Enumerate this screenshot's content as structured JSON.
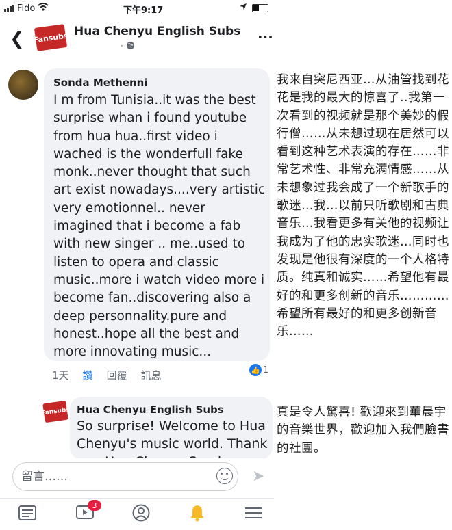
{
  "status_bar": {
    "carrier": "Fido",
    "time": "下午9:17"
  },
  "header": {
    "page_name": "Hua Chenyu English Subs",
    "sub": "·",
    "logo_text": "Fansubs"
  },
  "comment": {
    "author": "Sonda Methenni",
    "text": "I m from Tunisia..it was the best surprise whan i found youtube from hua hua..first video i wached is the wonderfull fake monk..never thought that such art exist nowadays....very artistic very emotionnel.. never imagined that i become a fab with new singer .. me..used to listen to opera and classic music..more i watch video more i become fan..discovering also a deep personnality.pure and honest..hope all the best and more innovating music...",
    "time": "1天",
    "like": "讚",
    "reply": "回覆",
    "message": "訊息",
    "reaction_count": "1"
  },
  "reply": {
    "author": "Hua Chenyu English Subs",
    "text": "So surprise!  Welcome to Hua Chenyu's music world. Thank you Hua Chenyu Sonda Methenni",
    "logo_text": "Fansubs"
  },
  "input": {
    "placeholder": "留言……"
  },
  "tabbar": {
    "video_badge": "3"
  },
  "annotation": {
    "translation": "我来自突尼西亚…从油管找到花花是我的最大的惊喜了..我第一次看到的视频就是那个美妙的假行僧……从未想过现在居然可以看到这种艺术表演的存在……非常艺术性、非常充满情感……从未想象过我会成了一个新歌手的歌迷…我…以前只听歌剧和古典音乐…我看更多有关他的视频让我成为了他的忠实歌迷…同时也发现是他很有深度的一个人格特质。纯真和诚实……希望他有最好的和更多创新的音乐…………希望所有最好的和更多创新音乐……",
    "welcome": "真是令人驚喜! 歡迎來到華晨宇的音樂世界，歡迎加入我們臉書的社團。"
  }
}
